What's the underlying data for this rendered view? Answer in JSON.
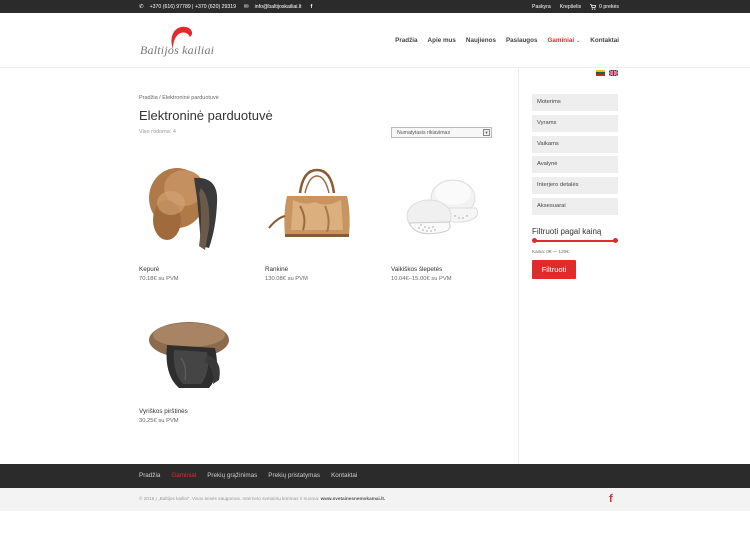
{
  "topbar": {
    "phones": "+370 (616) 97789 | +370 (620) 29319",
    "email": "info@baltijoskailiai.lt",
    "links": [
      "Paskyra",
      "Krepšelis"
    ],
    "cart": "0 prekės"
  },
  "logo": {
    "text": "Baltijos kailiai"
  },
  "nav": {
    "items": [
      "Pradžia",
      "Apie mus",
      "Naujienos",
      "Paslaugos",
      "Gaminiai",
      "Kontaktai"
    ],
    "active_index": 4
  },
  "breadcrumb": "Pradžia / Elektroninė parduotuvė",
  "page_title": "Elektroninė parduotuvė",
  "result_count": "Viso rodoma: 4",
  "sort": {
    "selected": "Numatytasis rikiavimas"
  },
  "products": [
    {
      "name": "Kepurė",
      "price": "70.18€ su PVM"
    },
    {
      "name": "Rankinė",
      "price": "130.08€ su PVM"
    },
    {
      "name": "Vaikiškos šlepetės",
      "price": "10.04€–15.00€ su PVM"
    },
    {
      "name": "Vyriškos pirštinės",
      "price": "30.25€ su PVM"
    }
  ],
  "sidebar": {
    "categories": [
      "Moterims",
      "Vyrams",
      "Vaikams",
      "Avalynė",
      "Interjero detalės",
      "Aksesuarai"
    ],
    "filter_title": "Filtruoti pagal kainą",
    "price_range": "Kaina: 0€ — 120€",
    "filter_button": "Filtruoti"
  },
  "footer": {
    "links": [
      "Pradžia",
      "Gaminiai",
      "Prekių grąžinimas",
      "Prekių pristatymas",
      "Kontaktai"
    ],
    "active_index": 1,
    "copyright": "© 2016 Į „Baltijos kailiai“. Visos teisės saugomos. Interneto svetainių kūrimas ir nuoma: ",
    "copyright_link": "www.svetainesnemokamai.lt."
  },
  "colors": {
    "accent": "#e02b2b",
    "dark": "#2b2b2b"
  }
}
